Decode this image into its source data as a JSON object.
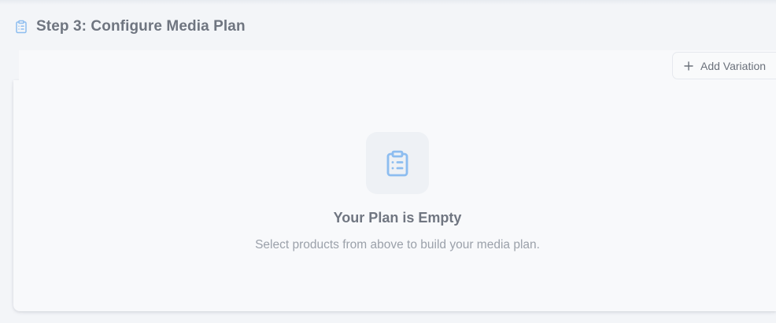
{
  "header": {
    "title": "Step 3: Configure Media Plan",
    "icon": "clipboard-list-icon"
  },
  "toolbar": {
    "add_variation_label": "Add Variation",
    "add_icon": "plus-icon"
  },
  "empty_state": {
    "icon": "clipboard-list-icon",
    "title": "Your Plan is Empty",
    "subtitle": "Select products from above to build your media plan."
  },
  "colors": {
    "accent_icon": "#8dbdf0",
    "heading": "#6f7580",
    "muted_text": "#9ba1aa",
    "panel_bg": "#f8f9fb",
    "page_bg": "#f3f5f8"
  }
}
